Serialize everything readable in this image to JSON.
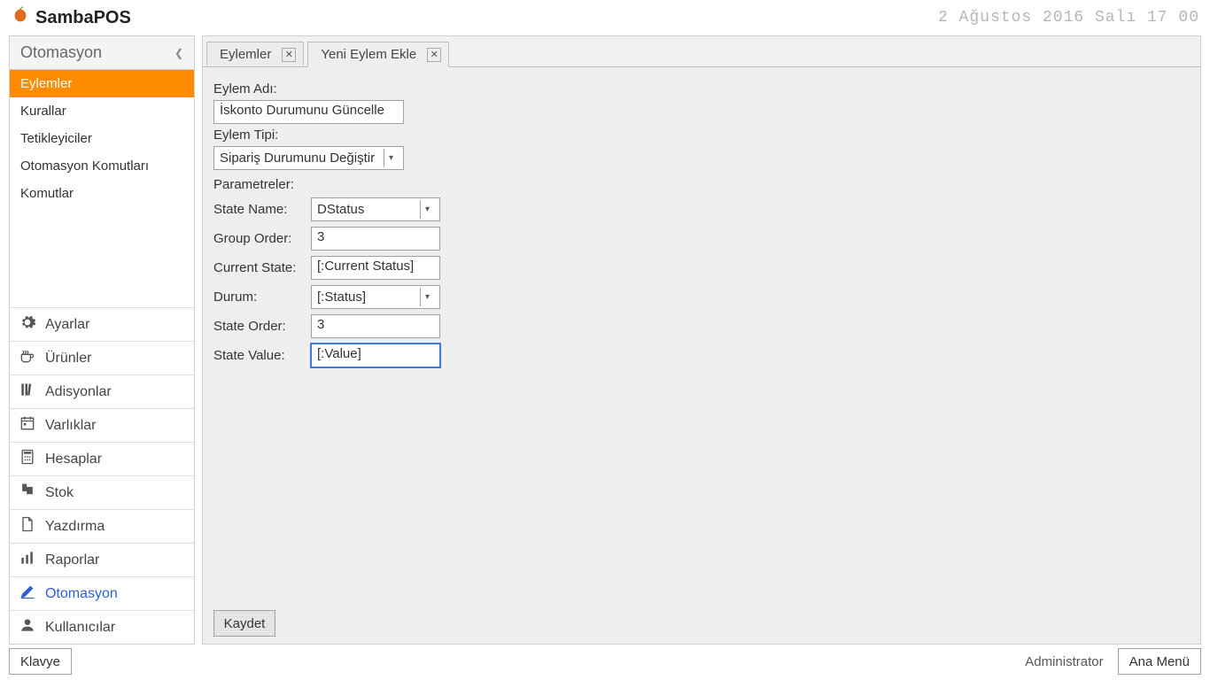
{
  "brand": "SambaPOS",
  "clock": "2 Ağustos 2016 Salı 17 00",
  "sidebar": {
    "header": "Otomasyon",
    "items": [
      {
        "label": "Eylemler",
        "active": true
      },
      {
        "label": "Kurallar"
      },
      {
        "label": "Tetikleyiciler"
      },
      {
        "label": "Otomasyon Komutları"
      },
      {
        "label": "Komutlar"
      }
    ],
    "nav": [
      {
        "label": "Ayarlar",
        "icon": "gear"
      },
      {
        "label": "Ürünler",
        "icon": "cup"
      },
      {
        "label": "Adisyonlar",
        "icon": "books"
      },
      {
        "label": "Varlıklar",
        "icon": "calendar"
      },
      {
        "label": "Hesaplar",
        "icon": "calc"
      },
      {
        "label": "Stok",
        "icon": "flag"
      },
      {
        "label": "Yazdırma",
        "icon": "file"
      },
      {
        "label": "Raporlar",
        "icon": "bars"
      },
      {
        "label": "Otomasyon",
        "icon": "pencil",
        "active": true
      },
      {
        "label": "Kullanıcılar",
        "icon": "user"
      }
    ]
  },
  "tabs": [
    {
      "label": "Eylemler",
      "active": false
    },
    {
      "label": "Yeni Eylem Ekle",
      "active": true
    }
  ],
  "form": {
    "name_label": "Eylem Adı:",
    "name_value": "İskonto Durumunu Güncelle",
    "type_label": "Eylem Tipi:",
    "type_value": "Sipariş Durumunu Değiştir",
    "params_label": "Parametreler:",
    "params": [
      {
        "label": "State Name:",
        "value": "DStatus",
        "kind": "combo"
      },
      {
        "label": "Group Order:",
        "value": "3",
        "kind": "text"
      },
      {
        "label": "Current State:",
        "value": "[:Current Status]",
        "kind": "text"
      },
      {
        "label": "Durum:",
        "value": "[:Status]",
        "kind": "combo"
      },
      {
        "label": "State Order:",
        "value": "3",
        "kind": "text"
      },
      {
        "label": "State Value:",
        "value": "[:Value]",
        "kind": "text",
        "focused": true
      }
    ],
    "save_label": "Kaydet"
  },
  "footer": {
    "keyboard": "Klavye",
    "admin": "Administrator",
    "main_menu": "Ana Menü"
  }
}
